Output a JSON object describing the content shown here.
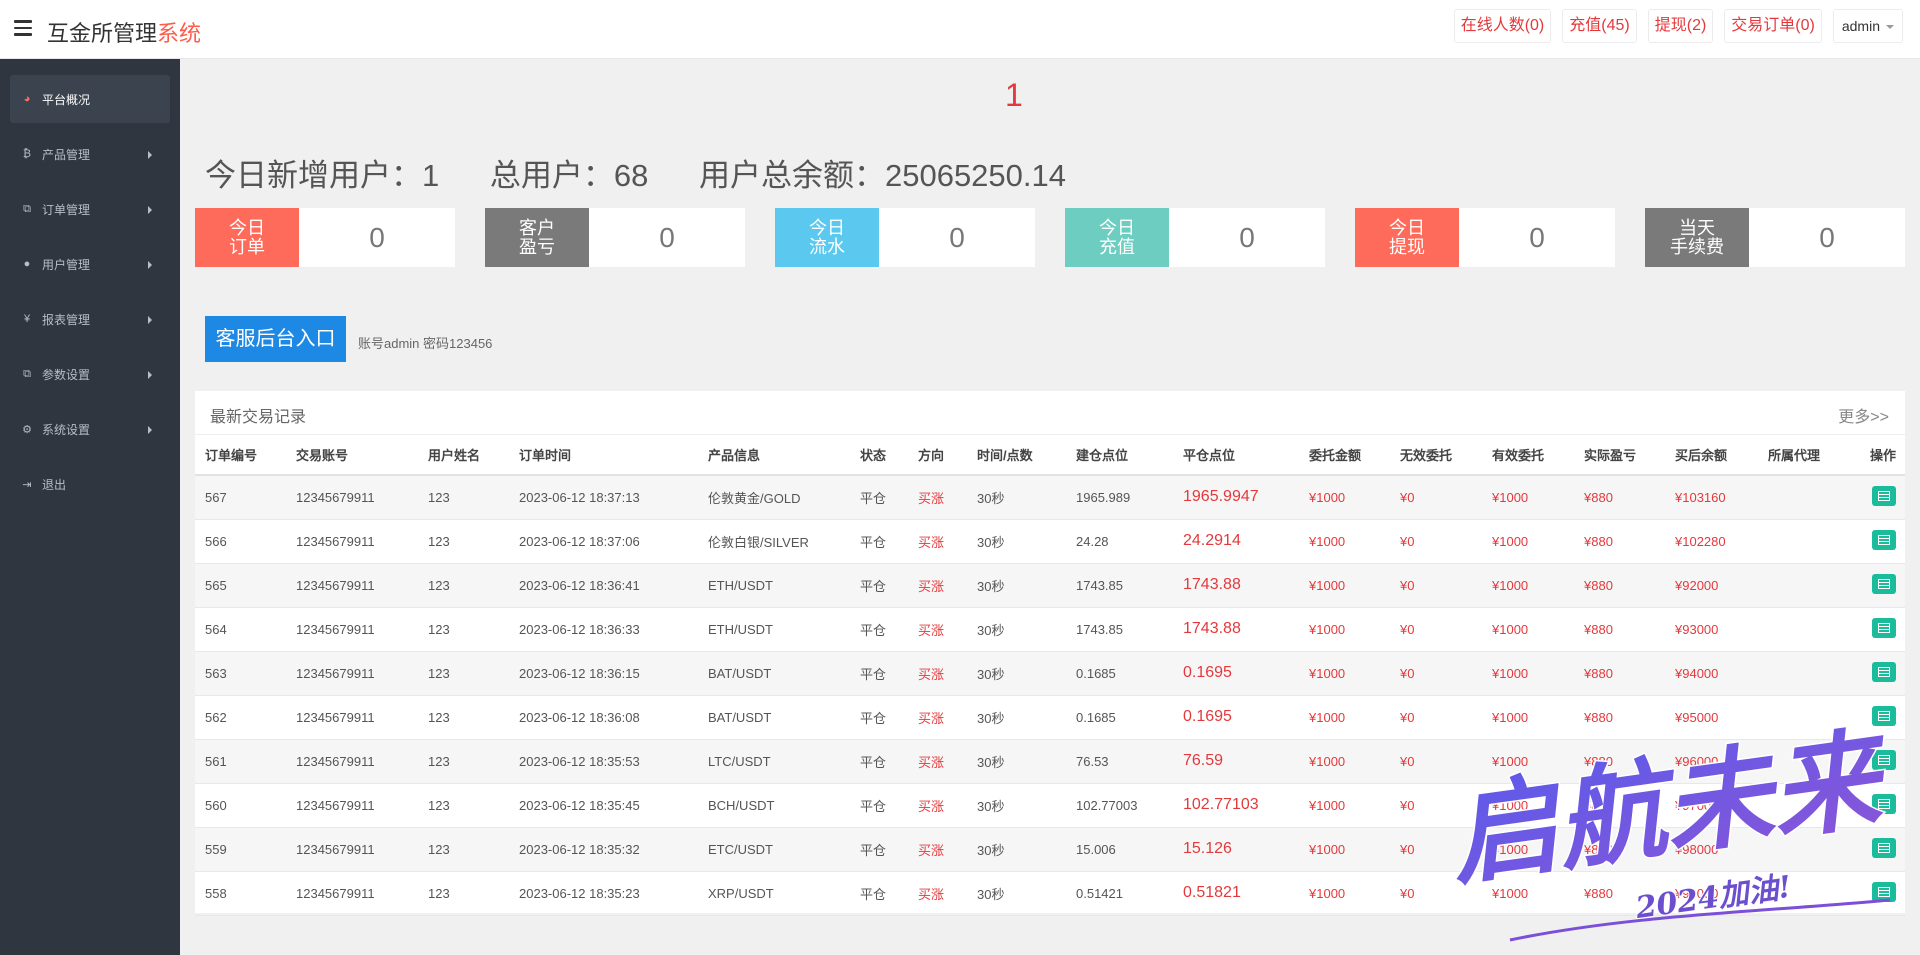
{
  "header": {
    "brand_main": "互金所管理",
    "brand_accent": "系统",
    "buttons": {
      "online": "在线人数(0)",
      "recharge": "充值(45)",
      "withdraw": "提现(2)",
      "orders": "交易订单(0)",
      "user": "admin"
    }
  },
  "sidebar": {
    "items": [
      {
        "label": "平台概况",
        "icon": "dashboard-icon"
      },
      {
        "label": "产品管理",
        "icon": "bitcoin-icon"
      },
      {
        "label": "订单管理",
        "icon": "copy-icon"
      },
      {
        "label": "用户管理",
        "icon": "user-icon"
      },
      {
        "label": "报表管理",
        "icon": "yen-icon"
      },
      {
        "label": "参数设置",
        "icon": "copy-icon"
      },
      {
        "label": "系统设置",
        "icon": "cogs-icon"
      },
      {
        "label": "退出",
        "icon": "sign-out-icon"
      }
    ]
  },
  "main": {
    "big_number": "1",
    "stats": {
      "new_users": "今日新增用户：1",
      "total_users": "总用户：68",
      "total_balance": "用户总余额：25065250.14"
    },
    "cards": [
      {
        "label1": "今日",
        "label2": "订单",
        "value": "0",
        "color": "#ff6b5b"
      },
      {
        "label1": "客户",
        "label2": "盈亏",
        "value": "0",
        "color": "#7a7a7a"
      },
      {
        "label1": "今日",
        "label2": "流水",
        "value": "0",
        "color": "#5bc8f0"
      },
      {
        "label1": "今日",
        "label2": "充值",
        "value": "0",
        "color": "#6ccdc0"
      },
      {
        "label1": "今日",
        "label2": "提现",
        "value": "0",
        "color": "#ff6b5b"
      },
      {
        "label1": "当天",
        "label2": "手续费",
        "value": "0",
        "color": "#7a7a7a"
      }
    ],
    "kf_button": "客服后台入口",
    "kf_note": "账号admin 密码123456"
  },
  "table": {
    "title": "最新交易记录",
    "more": "更多>>",
    "headers": [
      "订单编号",
      "交易账号",
      "用户姓名",
      "订单时间",
      "产品信息",
      "状态",
      "方向",
      "时间/点数",
      "建仓点位",
      "平仓点位",
      "委托金额",
      "无效委托",
      "有效委托",
      "实际盈亏",
      "买后余额",
      "所属代理",
      "操作"
    ],
    "rows": [
      {
        "id": "567",
        "account": "12345679911",
        "name": "123",
        "time": "2023-06-12 18:37:13",
        "product": "伦敦黄金/GOLD",
        "status": "平仓",
        "direction": "买涨",
        "period": "30秒",
        "open": "1965.989",
        "close": "1965.9947",
        "amount": "¥1000",
        "invalid": "¥0",
        "valid": "¥1000",
        "profit": "¥880",
        "balance": "¥103160",
        "agent": ""
      },
      {
        "id": "566",
        "account": "12345679911",
        "name": "123",
        "time": "2023-06-12 18:37:06",
        "product": "伦敦白银/SILVER",
        "status": "平仓",
        "direction": "买涨",
        "period": "30秒",
        "open": "24.28",
        "close": "24.2914",
        "amount": "¥1000",
        "invalid": "¥0",
        "valid": "¥1000",
        "profit": "¥880",
        "balance": "¥102280",
        "agent": ""
      },
      {
        "id": "565",
        "account": "12345679911",
        "name": "123",
        "time": "2023-06-12 18:36:41",
        "product": "ETH/USDT",
        "status": "平仓",
        "direction": "买涨",
        "period": "30秒",
        "open": "1743.85",
        "close": "1743.88",
        "amount": "¥1000",
        "invalid": "¥0",
        "valid": "¥1000",
        "profit": "¥880",
        "balance": "¥92000",
        "agent": ""
      },
      {
        "id": "564",
        "account": "12345679911",
        "name": "123",
        "time": "2023-06-12 18:36:33",
        "product": "ETH/USDT",
        "status": "平仓",
        "direction": "买涨",
        "period": "30秒",
        "open": "1743.85",
        "close": "1743.88",
        "amount": "¥1000",
        "invalid": "¥0",
        "valid": "¥1000",
        "profit": "¥880",
        "balance": "¥93000",
        "agent": ""
      },
      {
        "id": "563",
        "account": "12345679911",
        "name": "123",
        "time": "2023-06-12 18:36:15",
        "product": "BAT/USDT",
        "status": "平仓",
        "direction": "买涨",
        "period": "30秒",
        "open": "0.1685",
        "close": "0.1695",
        "amount": "¥1000",
        "invalid": "¥0",
        "valid": "¥1000",
        "profit": "¥880",
        "balance": "¥94000",
        "agent": ""
      },
      {
        "id": "562",
        "account": "12345679911",
        "name": "123",
        "time": "2023-06-12 18:36:08",
        "product": "BAT/USDT",
        "status": "平仓",
        "direction": "买涨",
        "period": "30秒",
        "open": "0.1685",
        "close": "0.1695",
        "amount": "¥1000",
        "invalid": "¥0",
        "valid": "¥1000",
        "profit": "¥880",
        "balance": "¥95000",
        "agent": ""
      },
      {
        "id": "561",
        "account": "12345679911",
        "name": "123",
        "time": "2023-06-12 18:35:53",
        "product": "LTC/USDT",
        "status": "平仓",
        "direction": "买涨",
        "period": "30秒",
        "open": "76.53",
        "close": "76.59",
        "amount": "¥1000",
        "invalid": "¥0",
        "valid": "¥1000",
        "profit": "¥880",
        "balance": "¥96000",
        "agent": ""
      },
      {
        "id": "560",
        "account": "12345679911",
        "name": "123",
        "time": "2023-06-12 18:35:45",
        "product": "BCH/USDT",
        "status": "平仓",
        "direction": "买涨",
        "period": "30秒",
        "open": "102.77003",
        "close": "102.77103",
        "amount": "¥1000",
        "invalid": "¥0",
        "valid": "¥1000",
        "profit": "¥880",
        "balance": "¥97000",
        "agent": ""
      },
      {
        "id": "559",
        "account": "12345679911",
        "name": "123",
        "time": "2023-06-12 18:35:32",
        "product": "ETC/USDT",
        "status": "平仓",
        "direction": "买涨",
        "period": "30秒",
        "open": "15.006",
        "close": "15.126",
        "amount": "¥1000",
        "invalid": "¥0",
        "valid": "¥1000",
        "profit": "¥880",
        "balance": "¥98000",
        "agent": ""
      },
      {
        "id": "558",
        "account": "12345679911",
        "name": "123",
        "time": "2023-06-12 18:35:23",
        "product": "XRP/USDT",
        "status": "平仓",
        "direction": "买涨",
        "period": "30秒",
        "open": "0.51421",
        "close": "0.51821",
        "amount": "¥1000",
        "invalid": "¥0",
        "valid": "¥1000",
        "profit": "¥880",
        "balance": "¥99000",
        "agent": ""
      }
    ]
  },
  "watermark": {
    "text": "启航未来",
    "sub": "2024加油!"
  }
}
